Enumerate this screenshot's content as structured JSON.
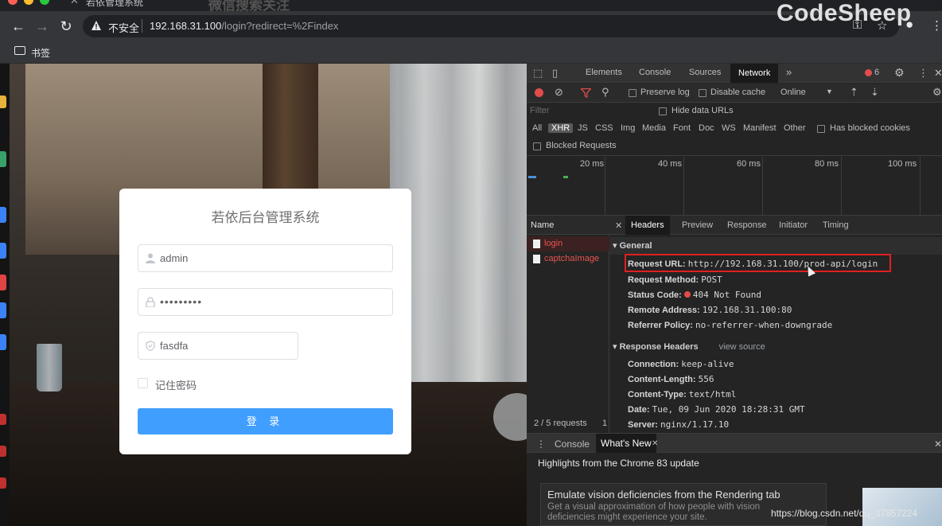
{
  "browser": {
    "tab_title": "若依管理系统",
    "faded_overlay_text": "微信搜索关注",
    "insecure_label": "不安全",
    "url_host": "192.168.31.100",
    "url_path": "/login?redirect=%2Findex",
    "bookmark_label": "书签",
    "watermark_brand": "CodeSheep"
  },
  "login": {
    "title": "若依后台管理系统",
    "username_value": "admin",
    "password_value": "•••••••••",
    "captcha_value": "fasdfa",
    "remember_label": "记住密码",
    "submit_label": "登 录"
  },
  "devtools": {
    "tabs": [
      "Elements",
      "Console",
      "Sources",
      "Network"
    ],
    "active_tab": "Network",
    "more": "»",
    "error_count": "6",
    "toolbar": {
      "preserve_log": "Preserve log",
      "disable_cache": "Disable cache",
      "throttle": "Online"
    },
    "filter": {
      "placeholder": "Filter",
      "hide_data_urls": "Hide data URLs",
      "types": [
        "All",
        "XHR",
        "JS",
        "CSS",
        "Img",
        "Media",
        "Font",
        "Doc",
        "WS",
        "Manifest",
        "Other"
      ],
      "active_type": "XHR",
      "blocked_cookies": "Has blocked cookies",
      "blocked_requests": "Blocked Requests"
    },
    "timeline_ticks": [
      "20 ms",
      "40 ms",
      "60 ms",
      "80 ms",
      "100 ms"
    ],
    "requests": {
      "header": "Name",
      "items": [
        "login",
        "captchaImage"
      ],
      "footer": "2 / 5 requests",
      "footer_extra": "1"
    },
    "detail_tabs": [
      "Headers",
      "Preview",
      "Response",
      "Initiator",
      "Timing"
    ],
    "active_detail_tab": "Headers",
    "general": {
      "title": "General",
      "request_url_key": "Request URL:",
      "request_url": "http://192.168.31.100/prod-api/login",
      "request_method_key": "Request Method:",
      "request_method": "POST",
      "status_code_key": "Status Code:",
      "status_code": "404 Not Found",
      "remote_address_key": "Remote Address:",
      "remote_address": "192.168.31.100:80",
      "referrer_policy_key": "Referrer Policy:",
      "referrer_policy": "no-referrer-when-downgrade"
    },
    "response_headers": {
      "title": "Response Headers",
      "view_source": "view source",
      "connection_key": "Connection:",
      "connection": "keep-alive",
      "content_length_key": "Content-Length:",
      "content_length": "556",
      "content_type_key": "Content-Type:",
      "content_type": "text/html",
      "date_key": "Date:",
      "date": "Tue, 09 Jun 2020 18:28:31 GMT",
      "server_key": "Server:",
      "server": "nginx/1.17.10"
    },
    "drawer": {
      "tabs": [
        "Console",
        "What's New"
      ],
      "active": "What's New",
      "highlights": "Highlights from the Chrome 83 update",
      "card_title": "Emulate vision deficiencies from the Rendering tab",
      "card_body": "Get a visual approximation of how people with vision deficiencies might experience your site."
    }
  },
  "watermark_url": "https://blog.csdn.net/qq_37857224",
  "colors": {
    "accent_blue": "#409eff",
    "error_red": "#e34c4c",
    "highlight_red": "#e02020"
  }
}
